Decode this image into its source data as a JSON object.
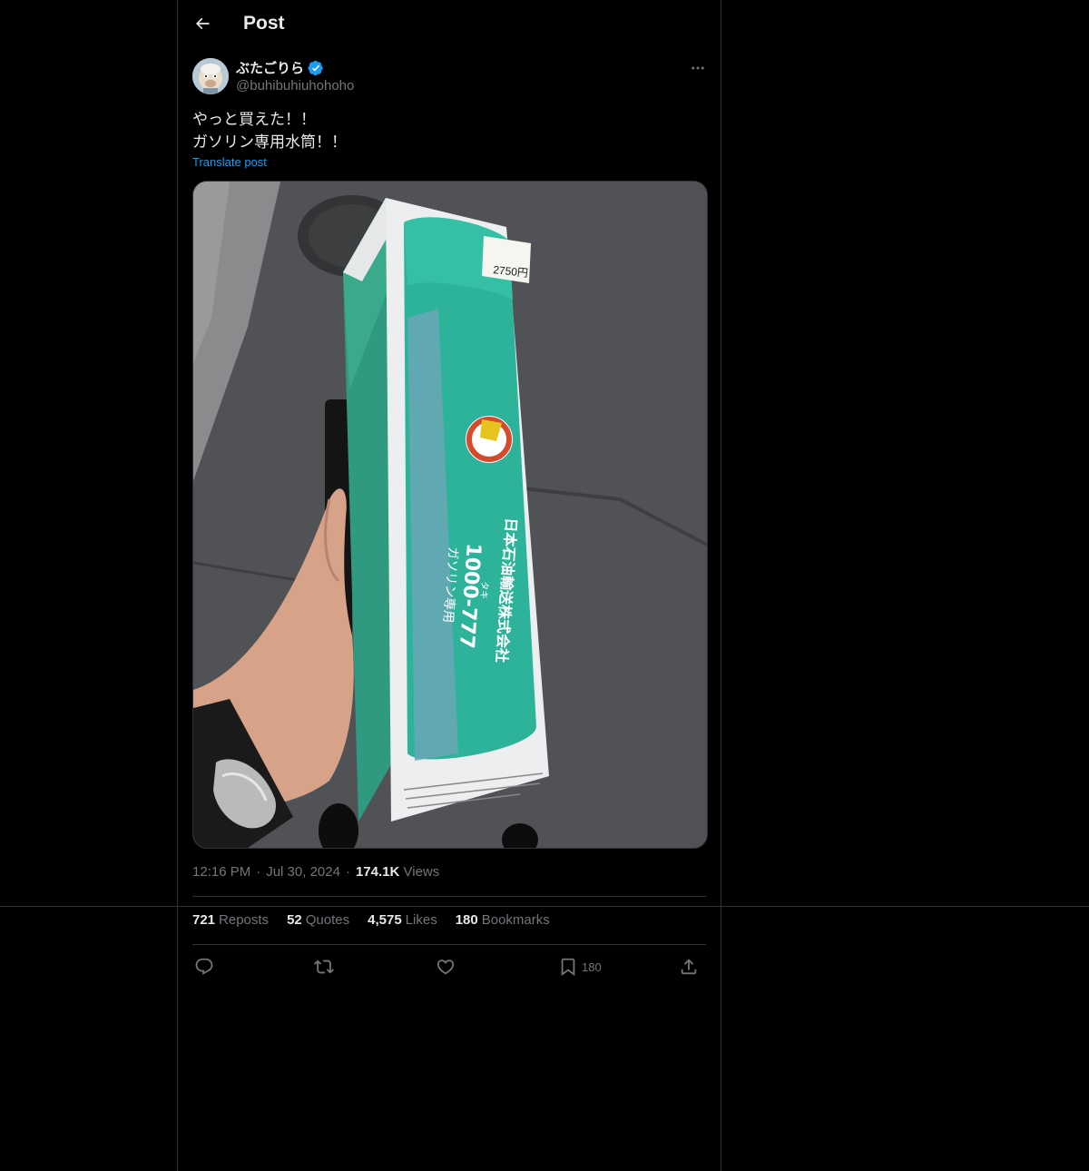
{
  "header": {
    "title": "Post"
  },
  "author": {
    "display_name": "ぶたごりら",
    "handle": "@buhibuhiuhohoho",
    "verified": true
  },
  "post": {
    "text": "やっと買えた！！\nガソリン専用水筒！！",
    "translate_label": "Translate post",
    "time": "12:16 PM",
    "date": "Jul 30, 2024",
    "views_count": "174.1K",
    "views_label": "Views"
  },
  "media": {
    "price_tag": "2750円",
    "product_company": "日本石油輸送株式会社",
    "product_code": "1000-777",
    "product_kana": "タキ",
    "product_sub": "ガソリン専用"
  },
  "stats": {
    "reposts_count": "721",
    "reposts_label": "Reposts",
    "quotes_count": "52",
    "quotes_label": "Quotes",
    "likes_count": "4,575",
    "likes_label": "Likes",
    "bookmarks_count": "180",
    "bookmarks_label": "Bookmarks"
  },
  "actions": {
    "bookmark_count": "180"
  },
  "colors": {
    "background": "#000000",
    "border": "#2f3336",
    "text_primary": "#e7e9ea",
    "text_secondary": "#71767b",
    "link": "#1d9bf0",
    "verified": "#1d9bf0"
  }
}
